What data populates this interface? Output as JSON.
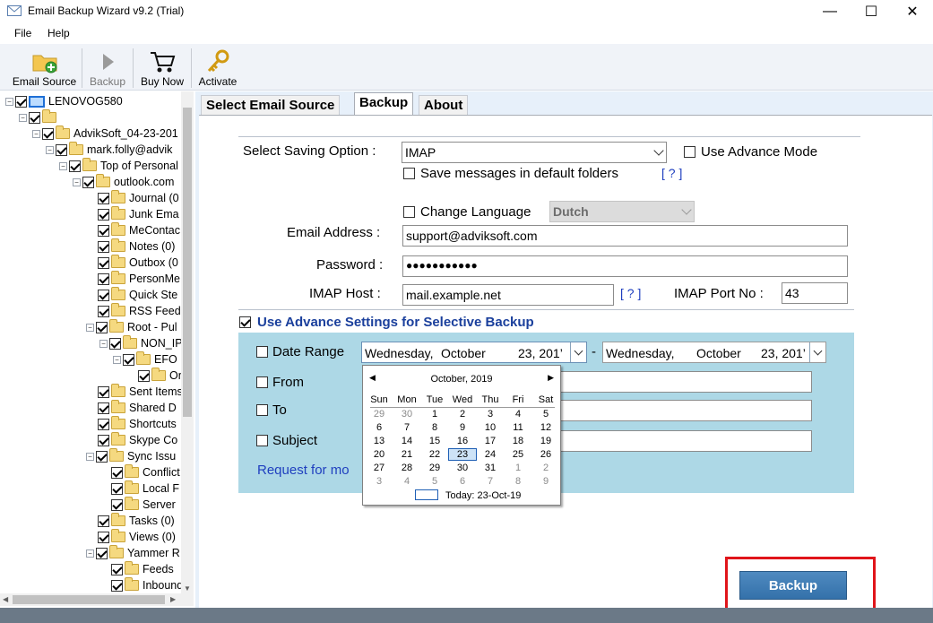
{
  "window": {
    "title": "Email Backup Wizard v9.2 (Trial)",
    "minimize": "—",
    "maximize": "☐",
    "close": "✕"
  },
  "menu": [
    {
      "label": "File"
    },
    {
      "label": "Help"
    }
  ],
  "toolbar": [
    {
      "label": "Email Source",
      "icon": "folder-add-icon"
    },
    {
      "label": "Backup",
      "icon": "play-icon"
    },
    {
      "label": "Buy Now",
      "icon": "cart-icon"
    },
    {
      "label": "Activate",
      "icon": "key-icon"
    }
  ],
  "tree": [
    {
      "label": "LENOVOG580"
    },
    {
      "label": ""
    },
    {
      "label": "AdvikSoft_04-23-201"
    },
    {
      "label": "mark.folly@advik"
    },
    {
      "label": "Top of Personal"
    },
    {
      "label": "outlook.com"
    },
    {
      "label": "Journal (0"
    },
    {
      "label": "Junk Ema"
    },
    {
      "label": "MeContac"
    },
    {
      "label": "Notes (0)"
    },
    {
      "label": "Outbox (0"
    },
    {
      "label": "PersonMe"
    },
    {
      "label": "Quick Ste"
    },
    {
      "label": "RSS Feed"
    },
    {
      "label": "Root - Pul"
    },
    {
      "label": "NON_IP"
    },
    {
      "label": "EFO"
    },
    {
      "label": "Or"
    },
    {
      "label": "Sent Items"
    },
    {
      "label": "Shared D"
    },
    {
      "label": "Shortcuts"
    },
    {
      "label": "Skype Co"
    },
    {
      "label": "Sync Issu"
    },
    {
      "label": "Conflict"
    },
    {
      "label": "Local F"
    },
    {
      "label": "Server"
    },
    {
      "label": "Tasks (0)"
    },
    {
      "label": "Views (0)"
    },
    {
      "label": "Yammer R"
    },
    {
      "label": "Feeds"
    },
    {
      "label": "Inbound"
    }
  ],
  "tabs": [
    {
      "label": "Select Email Source"
    },
    {
      "label": "Backup"
    },
    {
      "label": "About"
    }
  ],
  "form": {
    "saving_option_label": "Select Saving Option :",
    "saving_option_value": "IMAP",
    "use_advance_mode": "Use Advance Mode",
    "save_default_folders": "Save messages in default folders",
    "help_link": "[ ? ]",
    "change_language": "Change Language",
    "language_value": "Dutch",
    "email_label": "Email Address :",
    "email_value": "support@adviksoft.com",
    "password_label": "Password :",
    "password_value": "●●●●●●●●●●●",
    "imap_host_label": "IMAP Host :",
    "imap_host_value": "mail.example.net",
    "imap_help": "[ ? ]",
    "imap_port_label": "IMAP Port No :",
    "imap_port_value": "43"
  },
  "advanced": {
    "title": "Use Advance Settings for Selective Backup",
    "date_range": "Date Range",
    "from_date": {
      "day": "Wednesday,",
      "month": "October",
      "date": "23, 201’"
    },
    "dash": "-",
    "to_date": {
      "day": "Wednesday,",
      "month": "October",
      "date": "23, 201’"
    },
    "from_label": "From",
    "to_label": "To",
    "subject_label": "Subject",
    "request_link": "Request for mo"
  },
  "calendar": {
    "month_label": "October, 2019",
    "prev": "◀",
    "next": "▶",
    "weekdays": [
      "Sun",
      "Mon",
      "Tue",
      "Wed",
      "Thu",
      "Fri",
      "Sat"
    ],
    "weeks": [
      [
        "29",
        "30",
        "1",
        "2",
        "3",
        "4",
        "5"
      ],
      [
        "6",
        "7",
        "8",
        "9",
        "10",
        "11",
        "12"
      ],
      [
        "13",
        "14",
        "15",
        "16",
        "17",
        "18",
        "19"
      ],
      [
        "20",
        "21",
        "22",
        "23",
        "24",
        "25",
        "26"
      ],
      [
        "27",
        "28",
        "29",
        "30",
        "31",
        "1",
        "2"
      ],
      [
        "3",
        "4",
        "5",
        "6",
        "7",
        "8",
        "9"
      ]
    ],
    "today_text": "Today: 23-Oct-19"
  },
  "backup_button": "Backup"
}
